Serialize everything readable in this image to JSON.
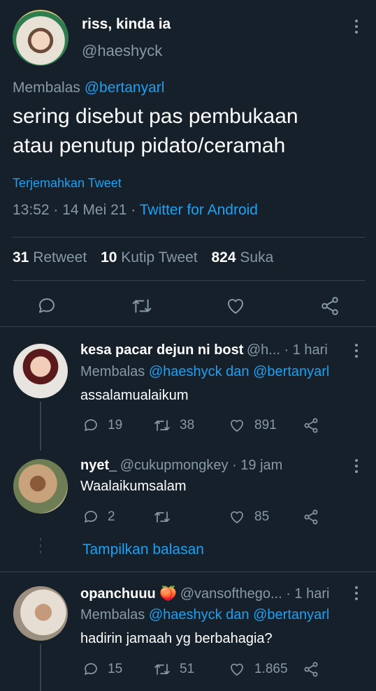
{
  "tweet": {
    "display_name": "riss, kinda ia",
    "handle": "@haeshyck",
    "reply_prefix": "Membalas",
    "reply_to": "@bertanyarl",
    "text_line1": "sering disebut pas pembukaan",
    "text_line2": "atau penutup pidato/ceramah",
    "translate": "Terjemahkan Tweet",
    "time_date": "13:52 · 14 Mei 21 ·",
    "source": "Twitter for Android",
    "retweets": "31",
    "retweets_label": "Retweet",
    "quotes": "10",
    "quotes_label": "Kutip Tweet",
    "likes": "824",
    "likes_label": "Suka"
  },
  "replies": [
    {
      "name": "kesa pacar dejun ni bost",
      "handle_time": "@h... · 1 hari",
      "reply_prefix": "Membalas",
      "reply_to": "@haeshyck dan @bertanyarl",
      "text": "assalamualaikum",
      "replies": "19",
      "retweets": "38",
      "likes": "891"
    },
    {
      "name": "nyet_",
      "handle_time": "@cukupmongkey · 19 jam",
      "text": "Waalaikumsalam",
      "replies": "2",
      "retweets": "",
      "likes": "85"
    },
    {
      "name": "opanchuuu 🍑",
      "handle_time": "@vansofthego... · 1 hari",
      "reply_prefix": "Membalas",
      "reply_to": "@haeshyck dan @bertanyarl",
      "text": "hadirin jamaah yg berbahagia?",
      "replies": "15",
      "retweets": "51",
      "likes": "1.865"
    }
  ],
  "show_replies": "Tampilkan balasan",
  "colors": {
    "background": "#15202b",
    "muted": "#8899a6",
    "accent": "#1da1f2",
    "divider": "#38444d"
  }
}
